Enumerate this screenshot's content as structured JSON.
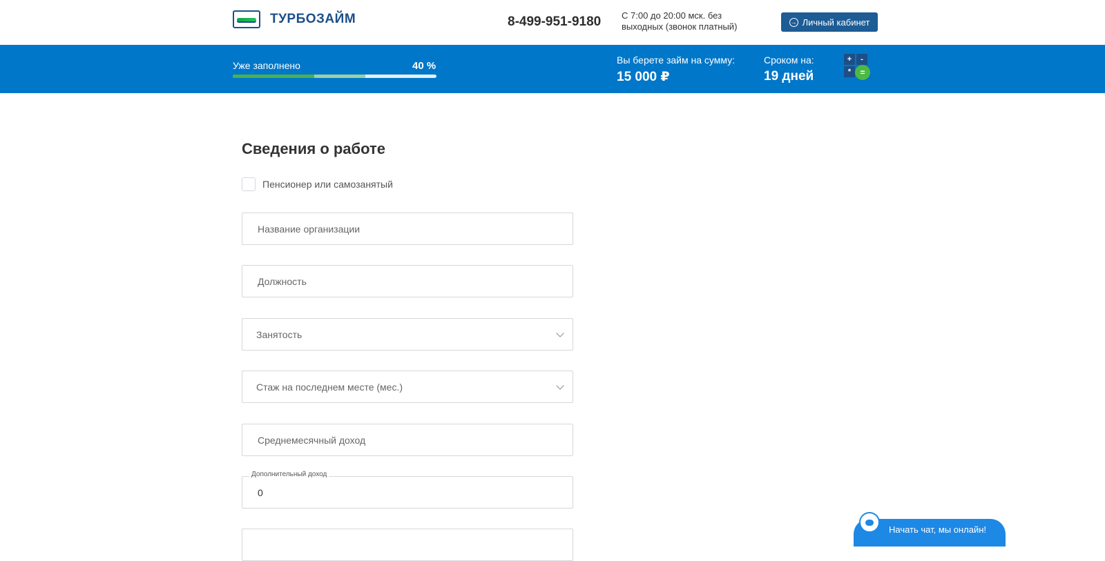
{
  "header": {
    "logo_text": "ТУРБОЗАЙМ",
    "phone": "8-499-951-9180",
    "hours": "С 7:00 до 20:00 мск. без выходных (звонок платный)",
    "cabinet_label": "Личный кабинет",
    "cabinet_icon": "login-icon"
  },
  "progress_bar": {
    "label": "Уже заполнено",
    "value_text": "40 %",
    "percent": 40,
    "loan_label": "Вы берете займ на сумму:",
    "loan_value": "15 000 ₽",
    "term_label": "Сроком на:",
    "term_value": "19 дней",
    "calculator_keys": [
      "+",
      "-",
      "*",
      "="
    ]
  },
  "form": {
    "title": "Сведения о работе",
    "pensioner_label": "Пенсионер или самозанятый",
    "organization_placeholder": "Название организации",
    "position_placeholder": "Должность",
    "employment_placeholder": "Занятость",
    "experience_placeholder": "Стаж на последнем месте (мес.)",
    "income_placeholder": "Среднемесячный доход",
    "extra_income_legend": "Дополнительный доход",
    "extra_income_value": "0"
  },
  "chat": {
    "label": "Начать чат, мы онлайн!"
  },
  "colors": {
    "brand_blue": "#0077c9",
    "button_blue": "#1d5c94",
    "progress_green": "#4caf50",
    "chat_blue": "#1e88e5"
  }
}
